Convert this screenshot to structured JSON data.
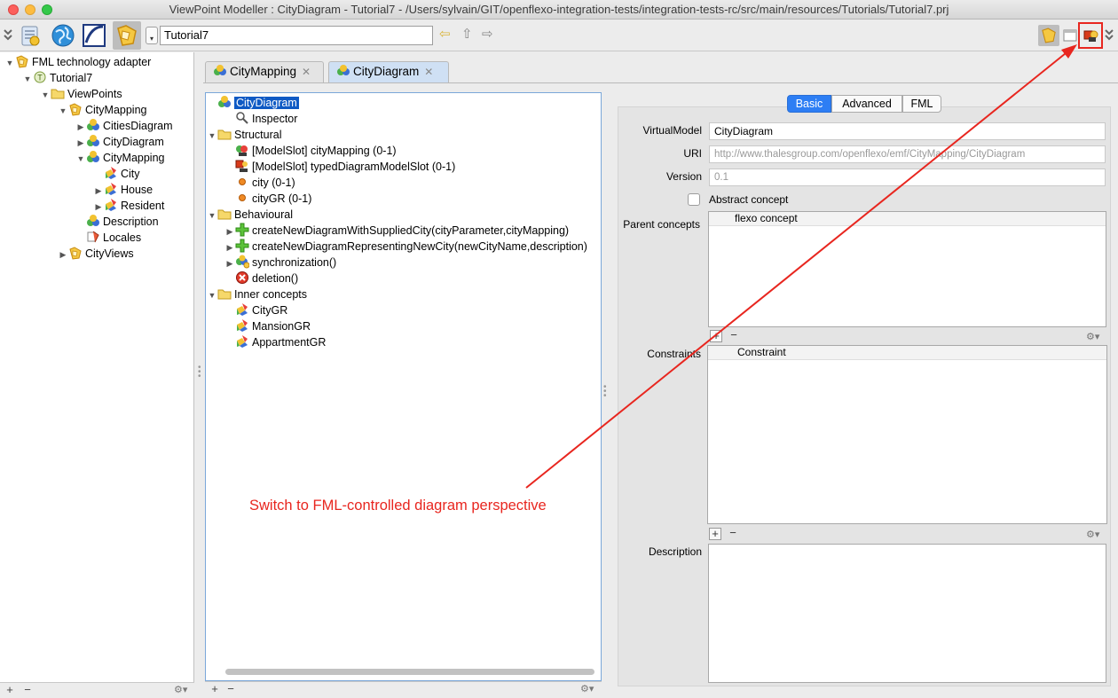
{
  "window": {
    "title": "ViewPoint Modeller : CityDiagram - Tutorial7 - /Users/sylvain/GIT/openflexo-integration-tests/integration-tests-rc/src/main/resources/Tutorials/Tutorial7.prj"
  },
  "toolbar": {
    "project_name": "Tutorial7",
    "icons": [
      "double-chevron-icon",
      "tools-icon",
      "globe-icon",
      "openflexo-icon",
      "fml-adapter-icon",
      "back-arrow-icon",
      "up-arrow-icon",
      "forward-arrow-icon"
    ],
    "right_icons": [
      "fml-perspective-icon",
      "window-icon",
      "fml-diagram-perspective-icon"
    ]
  },
  "left_tree": [
    {
      "label": "FML technology adapter",
      "level": 0,
      "expanded": true,
      "icon": "fml-adapter-icon"
    },
    {
      "label": "Tutorial7",
      "level": 1,
      "expanded": true,
      "icon": "project-icon"
    },
    {
      "label": "ViewPoints",
      "level": 2,
      "expanded": true,
      "icon": "folder-icon"
    },
    {
      "label": "CityMapping",
      "level": 3,
      "expanded": true,
      "icon": "viewpoint-icon"
    },
    {
      "label": "CitiesDiagram",
      "level": 4,
      "expanded": false,
      "icon": "virtual-model-icon"
    },
    {
      "label": "CityDiagram",
      "level": 4,
      "expanded": false,
      "icon": "virtual-model-icon"
    },
    {
      "label": "CityMapping",
      "level": 4,
      "expanded": true,
      "icon": "virtual-model-icon"
    },
    {
      "label": "City",
      "level": 5,
      "expanded": null,
      "icon": "concept-icon"
    },
    {
      "label": "House",
      "level": 5,
      "expanded": false,
      "icon": "concept-icon"
    },
    {
      "label": "Resident",
      "level": 5,
      "expanded": false,
      "icon": "concept-icon"
    },
    {
      "label": "Description",
      "level": 4,
      "expanded": null,
      "icon": "virtual-model-icon"
    },
    {
      "label": "Locales",
      "level": 4,
      "expanded": null,
      "icon": "locales-icon"
    },
    {
      "label": "CityViews",
      "level": 3,
      "expanded": false,
      "icon": "viewpoint-icon"
    }
  ],
  "tabs": [
    {
      "label": "CityMapping",
      "selected": false
    },
    {
      "label": "CityDiagram",
      "selected": true
    }
  ],
  "center_tree": [
    {
      "label": "CityDiagram",
      "level": 0,
      "expanded": null,
      "icon": "virtual-model-icon",
      "selected": true
    },
    {
      "label": "Inspector",
      "level": 1,
      "expanded": null,
      "icon": "inspector-icon"
    },
    {
      "label": "Structural",
      "level": 0,
      "expanded": true,
      "icon": "folder-icon"
    },
    {
      "label": "[ModelSlot] cityMapping (0-1)",
      "level": 1,
      "expanded": null,
      "icon": "modelslot-icon"
    },
    {
      "label": "[ModelSlot] typedDiagramModelSlot (0-1)",
      "level": 1,
      "expanded": null,
      "icon": "diagram-modelslot-icon"
    },
    {
      "label": "city (0-1)",
      "level": 1,
      "expanded": null,
      "icon": "property-icon"
    },
    {
      "label": "cityGR (0-1)",
      "level": 1,
      "expanded": null,
      "icon": "property-icon"
    },
    {
      "label": "Behavioural",
      "level": 0,
      "expanded": true,
      "icon": "folder-icon"
    },
    {
      "label": "createNewDiagramWithSuppliedCity(cityParameter,cityMapping)",
      "level": 1,
      "expanded": false,
      "icon": "creation-scheme-icon"
    },
    {
      "label": "createNewDiagramRepresentingNewCity(newCityName,description)",
      "level": 1,
      "expanded": false,
      "icon": "creation-scheme-icon"
    },
    {
      "label": "synchronization()",
      "level": 1,
      "expanded": false,
      "icon": "synchronization-scheme-icon"
    },
    {
      "label": "deletion()",
      "level": 1,
      "expanded": null,
      "icon": "deletion-scheme-icon"
    },
    {
      "label": "Inner concepts",
      "level": 0,
      "expanded": true,
      "icon": "folder-icon"
    },
    {
      "label": "CityGR",
      "level": 1,
      "expanded": null,
      "icon": "concept-icon"
    },
    {
      "label": "MansionGR",
      "level": 1,
      "expanded": null,
      "icon": "concept-icon"
    },
    {
      "label": "AppartmentGR",
      "level": 1,
      "expanded": null,
      "icon": "concept-icon"
    }
  ],
  "inspector": {
    "segments": [
      {
        "label": "Basic",
        "selected": true
      },
      {
        "label": "Advanced",
        "selected": false
      },
      {
        "label": "FML",
        "selected": false
      }
    ],
    "virtual_model_label": "VirtualModel",
    "virtual_model_value": "CityDiagram",
    "uri_label": "URI",
    "uri_value": "http://www.thalesgroup.com/openflexo/emf/CityMapping/CityDiagram",
    "version_label": "Version",
    "version_value": "0.1",
    "abstract_label": "Abstract concept",
    "abstract_checked": false,
    "parent_concepts_label": "Parent concepts",
    "parent_concepts_header": "flexo concept",
    "constraints_label": "Constraints",
    "constraints_header": "Constraint",
    "description_label": "Description",
    "description_value": ""
  },
  "annotation": {
    "text": "Switch to FML-controlled diagram perspective",
    "color": "#e8261f"
  },
  "colors": {
    "selection": "#0f5ac4",
    "tab_selected": "#cfe0f4",
    "segment_on": "#2d7ef4"
  }
}
